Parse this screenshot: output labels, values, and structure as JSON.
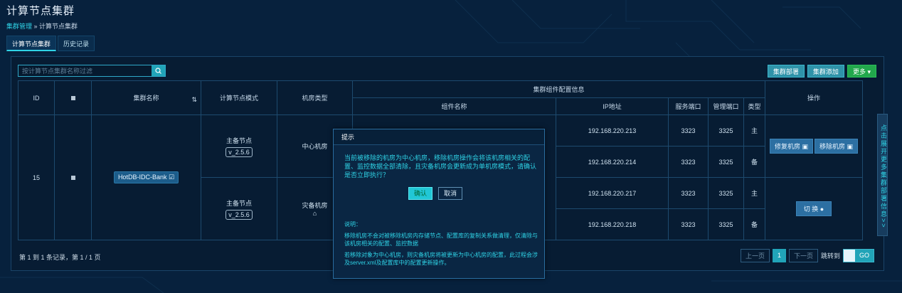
{
  "header": {
    "title": "计算节点集群",
    "crumb_link": "集群管理",
    "crumb_sep": " » ",
    "crumb_current": "计算节点集群"
  },
  "tabs": [
    {
      "label": "计算节点集群"
    },
    {
      "label": "历史记录"
    }
  ],
  "search": {
    "placeholder": "按计算节点集群名称过滤"
  },
  "toolbar": {
    "deploy": "集群部署",
    "add": "集群添加",
    "more": "更多"
  },
  "table": {
    "headers": {
      "id": "ID",
      "name": "集群名称",
      "mode": "计算节点模式",
      "room_type": "机房类型",
      "component_group": "集群组件配置信息",
      "component_name": "组件名称",
      "ip": "IP地址",
      "service_port": "服务端口",
      "manage_port": "管理端口",
      "type": "类型",
      "ops": "操作"
    },
    "row": {
      "id": "15",
      "name": "HotDB-IDC-Bank"
    },
    "groups": [
      {
        "mode": "主备节点",
        "version": "v_2.5.6",
        "room": "中心机房",
        "ips": [
          {
            "ip": "192.168.220.213",
            "sp": "3323",
            "mp": "3325",
            "t": "主"
          },
          {
            "ip": "192.168.220.214",
            "sp": "3323",
            "mp": "3325",
            "t": "备"
          }
        ]
      },
      {
        "mode": "主备节点",
        "version": "v_2.5.6",
        "room": "灾备机房",
        "ips": [
          {
            "ip": "192.168.220.217",
            "sp": "3323",
            "mp": "3325",
            "t": "主"
          },
          {
            "ip": "192.168.220.218",
            "sp": "3323",
            "mp": "3325",
            "t": "备"
          }
        ]
      }
    ],
    "ops": {
      "repair": "修复机房",
      "remove": "移除机房",
      "switch": "切 换"
    }
  },
  "pagination": {
    "info": "第 1 到 1 条记录，第 1 / 1 页",
    "prev": "上一页",
    "current": "1",
    "next": "下一页",
    "jump": "跳转到",
    "go": "GO"
  },
  "side_tab": "点击展开更多集群部署信息>>",
  "modal": {
    "title": "提示",
    "message": "当前被移除的机房为中心机房，移除机房操作会将该机房相关的配置、监控数据全部清除，且灾备机房会更新成为单机房模式，请确认是否立即执行？",
    "ok": "确认",
    "cancel": "取消",
    "note_title": "说明：",
    "note1": "移除机房不会对被移除机房内存储节点、配置库的复制关系做清理，仅清除与该机房相关的配置、监控数据",
    "note2": "若移除对象为中心机房，则灾备机房将被更新为中心机房的配置，此过程会涉及server.xml及配置库中的配置更新操作。"
  },
  "colors": {
    "accent": "#2fd3e6",
    "bg": "#07213d",
    "green": "#22a84c"
  }
}
